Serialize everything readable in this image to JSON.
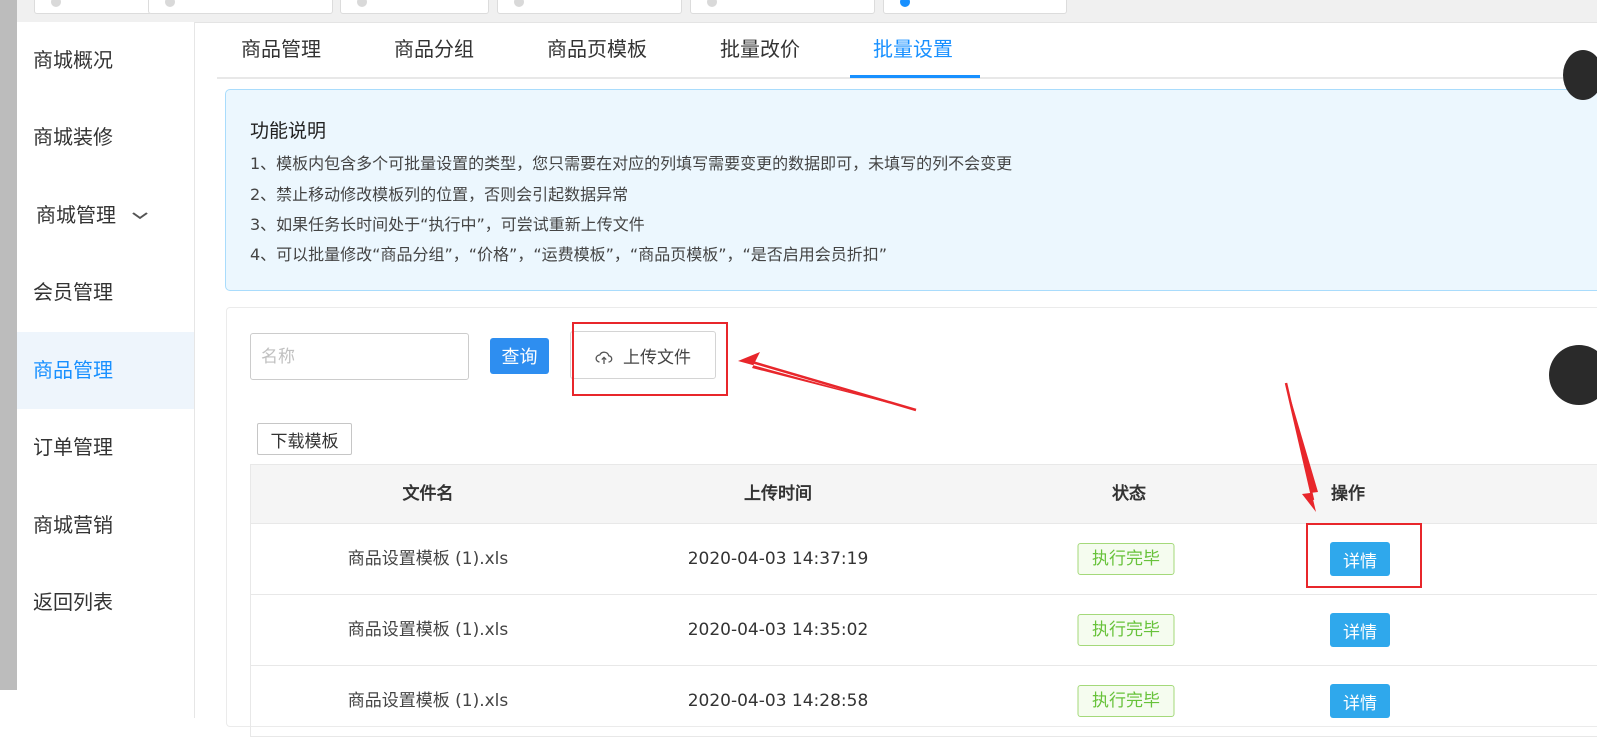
{
  "sidebar": {
    "items": [
      {
        "label": "商城概况"
      },
      {
        "label": "商城装修"
      },
      {
        "label": "商城管理"
      },
      {
        "label": "会员管理"
      },
      {
        "label": "商品管理"
      },
      {
        "label": "订单管理"
      },
      {
        "label": "商城营销"
      },
      {
        "label": "返回列表"
      }
    ],
    "active": "商品管理"
  },
  "subtabs": [
    {
      "label": "商品管理"
    },
    {
      "label": "商品分组"
    },
    {
      "label": "商品页模板"
    },
    {
      "label": "批量改价"
    },
    {
      "label": "批量设置"
    }
  ],
  "active_subtab": "批量设置",
  "info": {
    "title": "功能说明",
    "lines": [
      "1、模板内包含多个可批量设置的类型，您只需要在对应的列填写需要变更的数据即可，未填写的列不会变更",
      "2、禁止移动修改模板列的位置，否则会引起数据异常",
      "3、如果任务长时间处于“执行中”，可尝试重新上传文件",
      "4、可以批量修改“商品分组”，“价格”，“运费模板”，“商品页模板”，“是否启用会员折扣”"
    ]
  },
  "search": {
    "placeholder": "名称",
    "value": ""
  },
  "buttons": {
    "query": "查询",
    "upload": "上传文件",
    "download_template": "下载模板"
  },
  "table": {
    "headers": [
      "文件名",
      "上传时间",
      "状态",
      "操作"
    ],
    "rows": [
      {
        "file": "商品设置模板 (1).xls",
        "time": "2020-04-03 14:37:19",
        "status": "执行完毕",
        "action": "详情"
      },
      {
        "file": "商品设置模板 (1).xls",
        "time": "2020-04-03 14:35:02",
        "status": "执行完毕",
        "action": "详情"
      },
      {
        "file": "商品设置模板 (1).xls",
        "time": "2020-04-03 14:28:58",
        "status": "执行完毕",
        "action": "详情"
      }
    ]
  },
  "colors": {
    "primary": "#1890ff",
    "success": "#67c23a",
    "annotation": "#e8262b"
  },
  "icons": {
    "upload": "cloud-upload-icon",
    "chevron": "chevron-down-icon"
  }
}
